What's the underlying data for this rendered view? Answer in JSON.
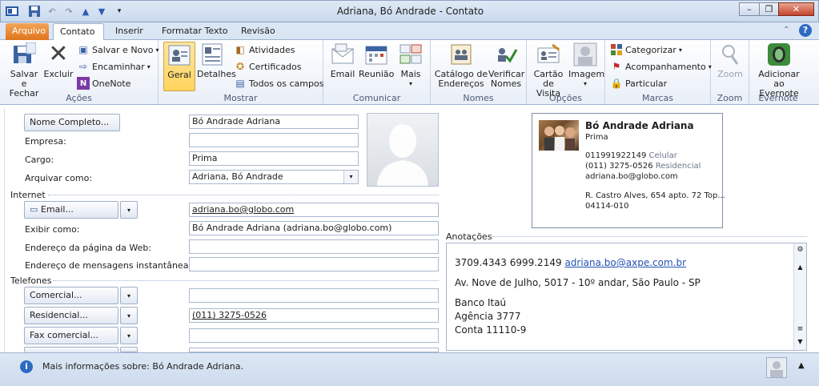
{
  "window": {
    "title": "Adriana, Bó Andrade  -  Contato"
  },
  "tabs": [
    {
      "label": "Arquivo"
    },
    {
      "label": "Contato"
    },
    {
      "label": "Inserir"
    },
    {
      "label": "Formatar Texto"
    },
    {
      "label": "Revisão"
    }
  ],
  "ribbon": {
    "acoes": {
      "label": "Ações",
      "save_close": "Salvar e Fechar",
      "save_close_l1": "Salvar e",
      "save_close_l2": "Fechar",
      "delete": "Excluir",
      "save_new": "Salvar e Novo",
      "forward": "Encaminhar",
      "onenote": "OneNote"
    },
    "mostrar": {
      "label": "Mostrar",
      "general": "Geral",
      "details": "Detalhes",
      "activities": "Atividades",
      "certificates": "Certificados",
      "all_fields": "Todos os campos"
    },
    "comunicar": {
      "label": "Comunicar",
      "email": "Email",
      "meeting": "Reunião",
      "more": "Mais"
    },
    "nomes": {
      "label": "Nomes",
      "address_book_l1": "Catálogo de",
      "address_book_l2": "Endereços",
      "check_names_l1": "Verificar",
      "check_names_l2": "Nomes"
    },
    "opcoes": {
      "label": "Opções",
      "business_card_l1": "Cartão",
      "business_card_l2": "de Visita",
      "picture": "Imagem"
    },
    "marcas": {
      "label": "Marcas",
      "categorize": "Categorizar",
      "follow_up": "Acompanhamento",
      "private": "Particular"
    },
    "zoom": {
      "label": "Zoom",
      "zoom": "Zoom"
    },
    "evernote": {
      "label": "Evernote",
      "add_l1": "Adicionar",
      "add_l2": "ao Evernote"
    }
  },
  "form": {
    "full_name_btn": "Nome Completo...",
    "full_name": "Bó Andrade Adriana",
    "company_label": "Empresa:",
    "company": "",
    "job_label": "Cargo:",
    "job": "Prima",
    "file_as_label": "Arquivar como:",
    "file_as": "Adriana, Bó Andrade",
    "internet_section": "Internet",
    "email_btn": "Email...",
    "email": "adriana.bo@globo.com",
    "display_as_label": "Exibir como:",
    "display_as": "Bó Andrade Adriana (adriana.bo@globo.com)",
    "webpage_label": "Endereço da página da Web:",
    "webpage": "",
    "im_label": "Endereço de mensagens instantâneas:",
    "im": "",
    "phones_section": "Telefones",
    "business_btn": "Comercial...",
    "business": "",
    "home_btn": "Residencial...",
    "home": "(011) 3275-0526",
    "fax_btn": "Fax comercial...",
    "fax": ""
  },
  "card": {
    "name": "Bó Andrade Adriana",
    "title": "Prima",
    "phone1": "011991922149",
    "phone1_type": "Celular",
    "phone2": "(011) 3275-0526",
    "phone2_type": "Residencial",
    "email": "adriana.bo@globo.com",
    "address": "R. Castro Alves, 654 apto. 72 Top...",
    "zip": "04114-010"
  },
  "notes": {
    "label": "Anotações",
    "line1_phones": "3709.4343  6999.2149",
    "line1_email": "adriana.bo@axpe.com.br",
    "line2": "Av. Nove de Julho, 5017 - 10º andar, São Paulo - SP",
    "line3": "Banco Itaú",
    "line4": "Agência 3777",
    "line5": "Conta 11110-9"
  },
  "status": {
    "text": "Mais informações sobre: Bó Andrade Adriana."
  }
}
